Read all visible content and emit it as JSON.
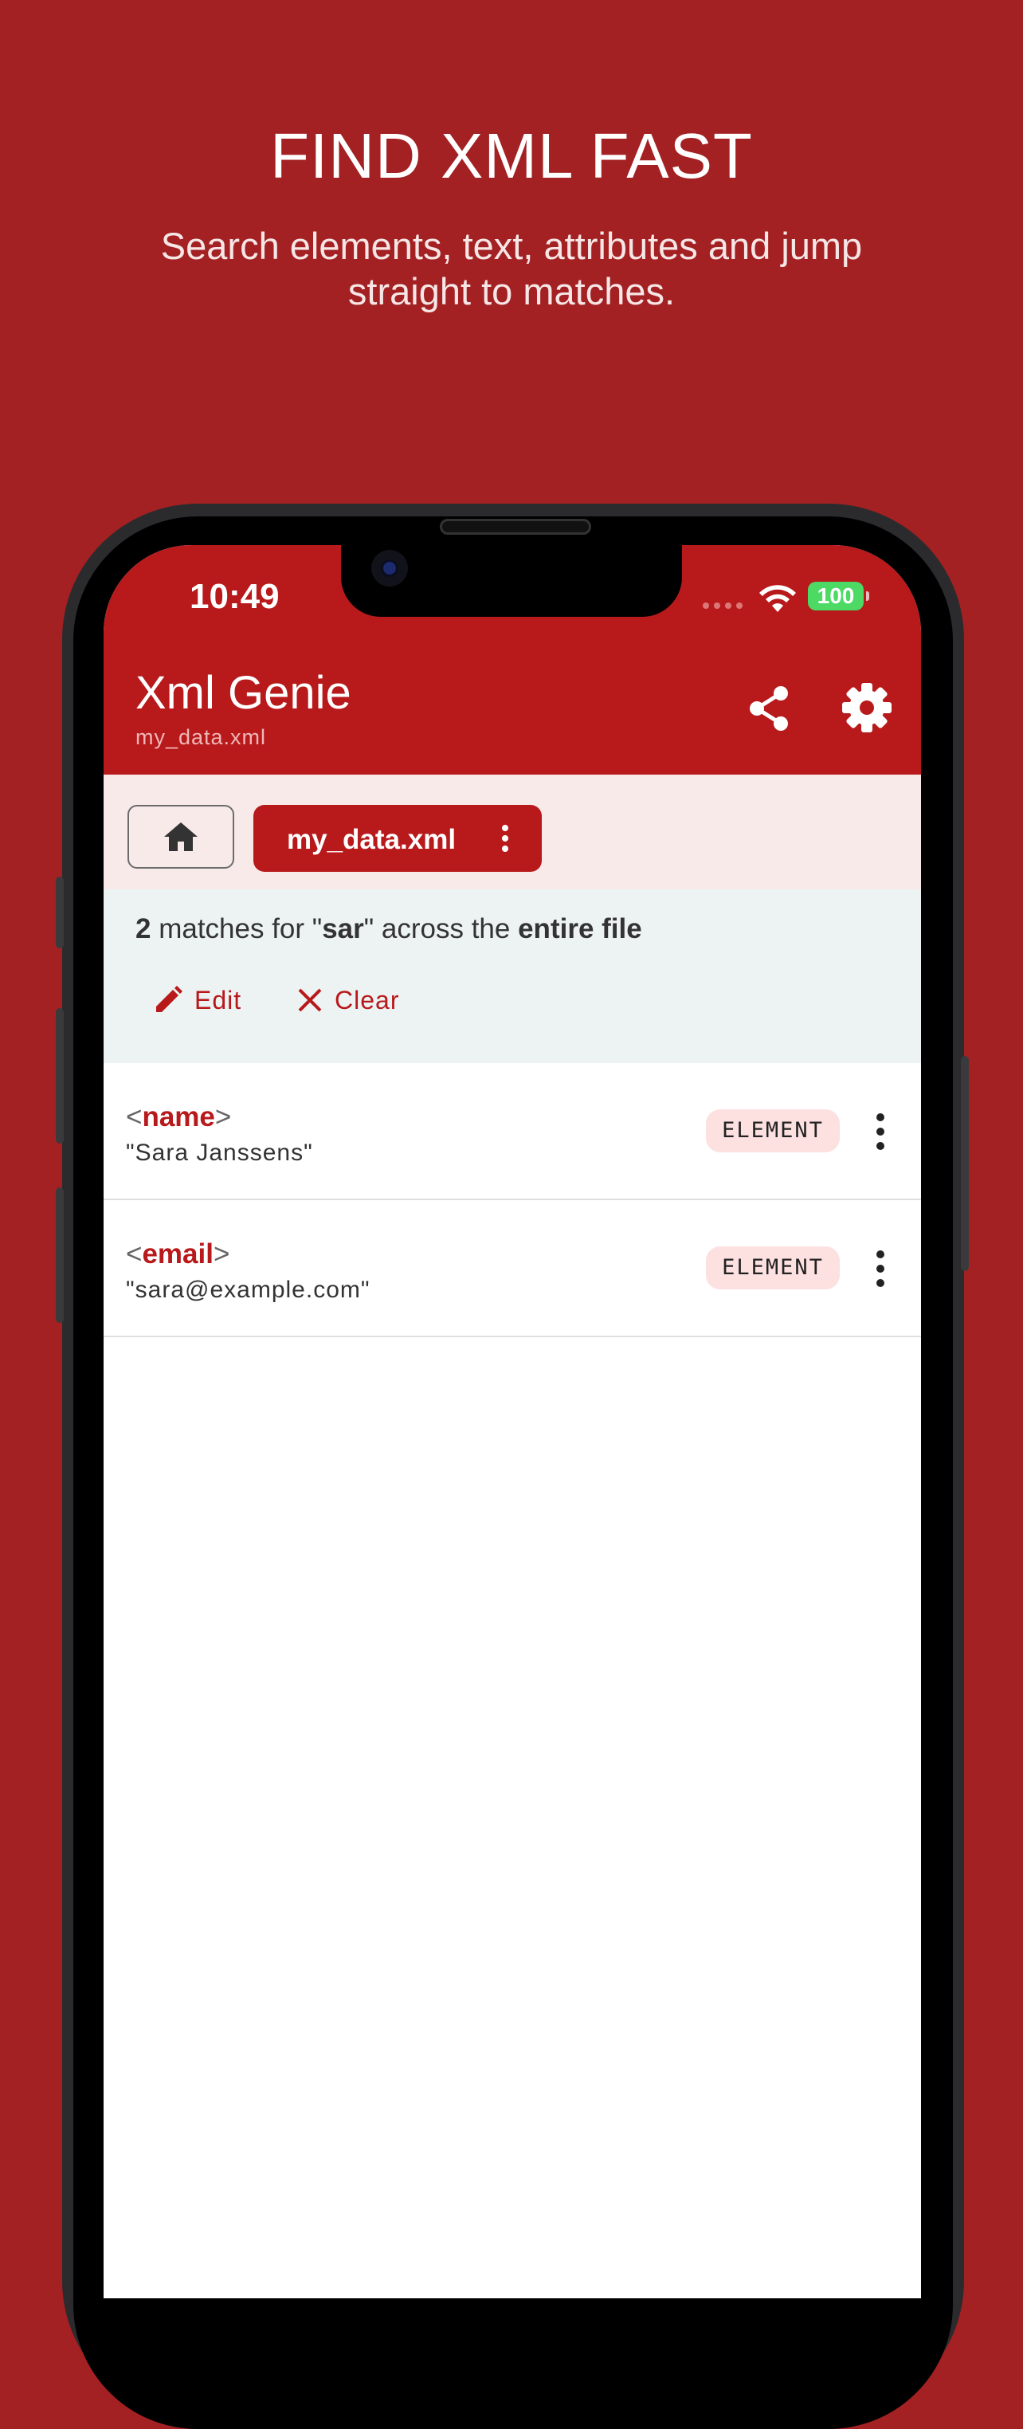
{
  "promo": {
    "title": "FIND XML FAST",
    "subtitle": "Search elements, text, attributes and jump straight to matches."
  },
  "status_bar": {
    "time": "10:49",
    "battery": "100"
  },
  "app_bar": {
    "title": "Xml Genie",
    "subtitle": "my_data.xml",
    "share_icon": "share-icon",
    "settings_icon": "gear-icon"
  },
  "tabs": {
    "home_icon": "home-icon",
    "file_label": "my_data.xml"
  },
  "search": {
    "count": "2",
    "text_matches_for": " matches for \"",
    "query": "sar",
    "text_across": "\" across the ",
    "scope": "entire file",
    "edit_label": "Edit",
    "clear_label": "Clear"
  },
  "results": [
    {
      "open": "<",
      "tag": "name",
      "close": ">",
      "text": "\"Sara Janssens\"",
      "type": "ELEMENT"
    },
    {
      "open": "<",
      "tag": "email",
      "close": ">",
      "text": "\"sara@example.com\"",
      "type": "ELEMENT"
    }
  ],
  "colors": {
    "background": "#a32123",
    "app_bar": "#b8191b",
    "tabs_bar": "#f9eaea",
    "search_header": "#edf3f3",
    "badge": "#fde0e0"
  }
}
